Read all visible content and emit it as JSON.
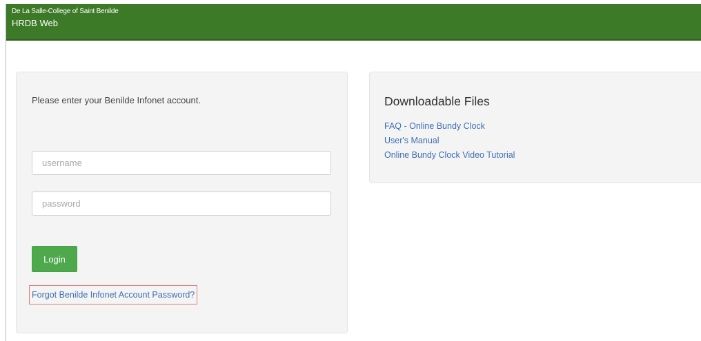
{
  "header": {
    "org_name": "De La Salle-College of Saint Benilde",
    "app_name": "HRDB Web",
    "color": "#3c7a28"
  },
  "login": {
    "prompt": "Please enter your Benilde Infonet account.",
    "username_placeholder": "username",
    "password_placeholder": "password",
    "login_label": "Login",
    "forgot_label": "Forgot Benilde Infonet Account Password?",
    "button_color": "#4ea94c"
  },
  "downloads": {
    "title": "Downloadable Files",
    "links": [
      {
        "label": "FAQ - Online Bundy Clock"
      },
      {
        "label": "User's Manual"
      },
      {
        "label": "Online Bundy Clock Video Tutorial"
      }
    ],
    "link_color": "#3f6fb3"
  }
}
